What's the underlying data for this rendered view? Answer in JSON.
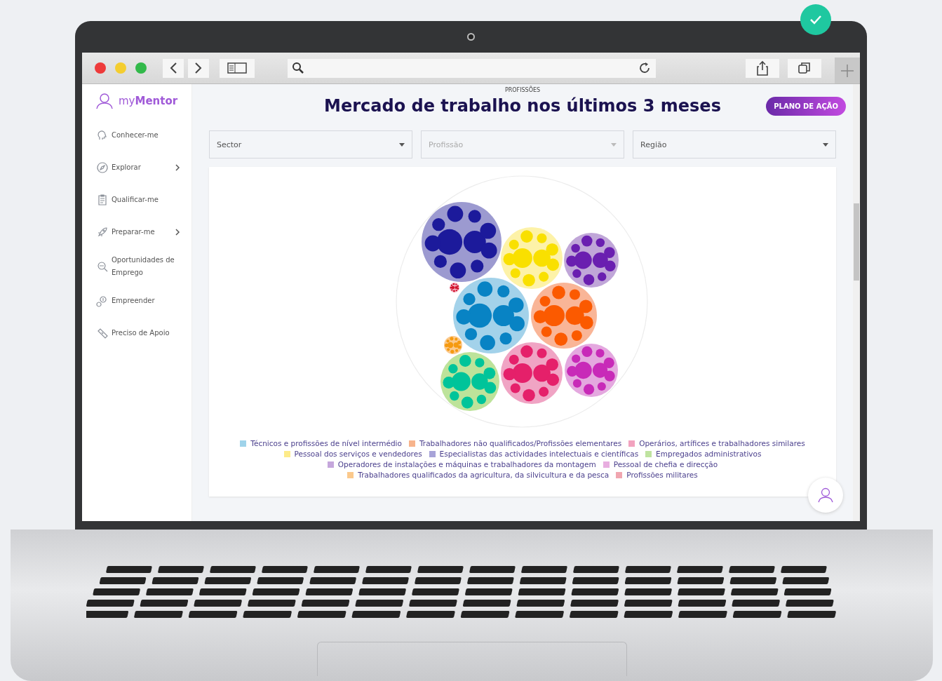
{
  "brand": {
    "prefix": "my",
    "name": "Mentor"
  },
  "sidebar": {
    "items": [
      {
        "label": "Conhecer-me",
        "has_submenu": false
      },
      {
        "label": "Explorar",
        "has_submenu": true
      },
      {
        "label": "Qualificar-me",
        "has_submenu": false
      },
      {
        "label": "Preparar-me",
        "has_submenu": true
      },
      {
        "label": "Oportunidades de Emprego",
        "has_submenu": false
      },
      {
        "label": "Empreender",
        "has_submenu": false
      },
      {
        "label": "Preciso de Apoio",
        "has_submenu": false
      }
    ]
  },
  "header": {
    "section": "PROFISSÕES",
    "title": "Mercado de trabalho nos últimos 3 meses",
    "action_button": "PLANO DE AÇÃO"
  },
  "filters": [
    {
      "placeholder": "Sector",
      "disabled": false
    },
    {
      "placeholder": "Profissão",
      "disabled": true
    },
    {
      "placeholder": "Região",
      "disabled": false
    }
  ],
  "legend_rows": [
    [
      {
        "label": "Técnicos e profissões de nível intermédio",
        "color": "#9fd3ea"
      },
      {
        "label": "Trabalhadores não qualificados/Profissões elementares",
        "color": "#f7b48c"
      },
      {
        "label": "Operários, artífices e trabalhadores similares",
        "color": "#f2a3bf"
      }
    ],
    [
      {
        "label": "Pessoal dos serviços e vendedores",
        "color": "#fdeb8a"
      },
      {
        "label": "Especialistas das actividades intelectuais e científicas",
        "color": "#a7a3d8"
      },
      {
        "label": "Empregados administrativos",
        "color": "#bfe3a0"
      }
    ],
    [
      {
        "label": "Operadores de instalações e máquinas e trabalhadores da montagem",
        "color": "#c5a7dc"
      },
      {
        "label": "Pessoal de chefia e direcção",
        "color": "#e8aee0"
      }
    ],
    [
      {
        "label": "Trabalhadores qualificados da agricultura, da silvicultura e da pesca",
        "color": "#fbc98c"
      },
      {
        "label": "Profissões militares",
        "color": "#f0a6b0"
      }
    ]
  ]
}
